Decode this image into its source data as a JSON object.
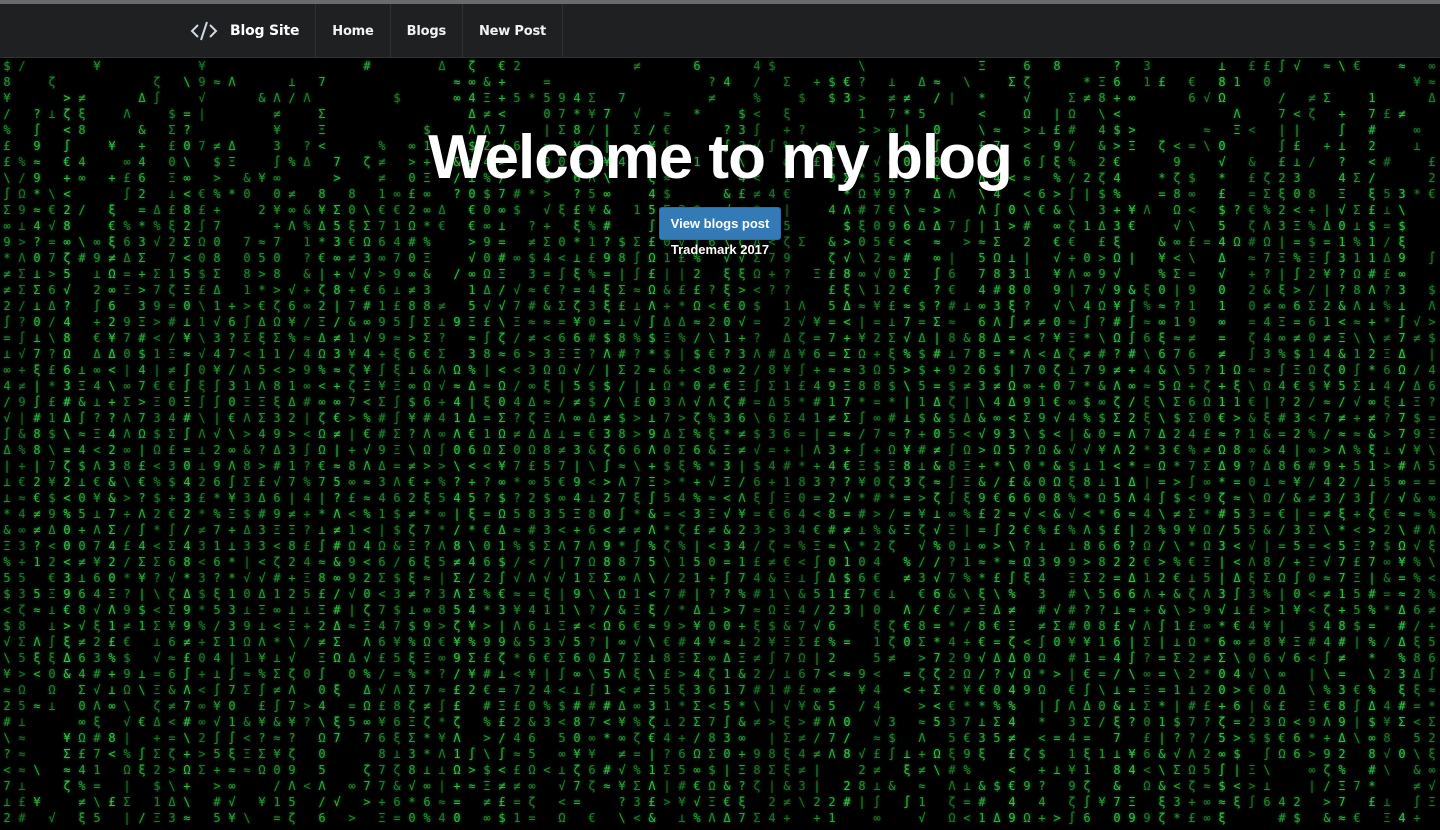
{
  "nav": {
    "brand_label": "Blog Site",
    "links": [
      {
        "label": "Home"
      },
      {
        "label": "Blogs"
      },
      {
        "label": "New Post"
      }
    ]
  },
  "hero": {
    "title": "Welcome to my blog",
    "button_label": "View blogs post",
    "trademark": "Trademark 2017"
  },
  "icons": {
    "brand": "code-icon"
  },
  "colors": {
    "navbar_bg": "#1f2022",
    "button_bg": "#337ab7",
    "rain_green": "#38c94a"
  }
}
